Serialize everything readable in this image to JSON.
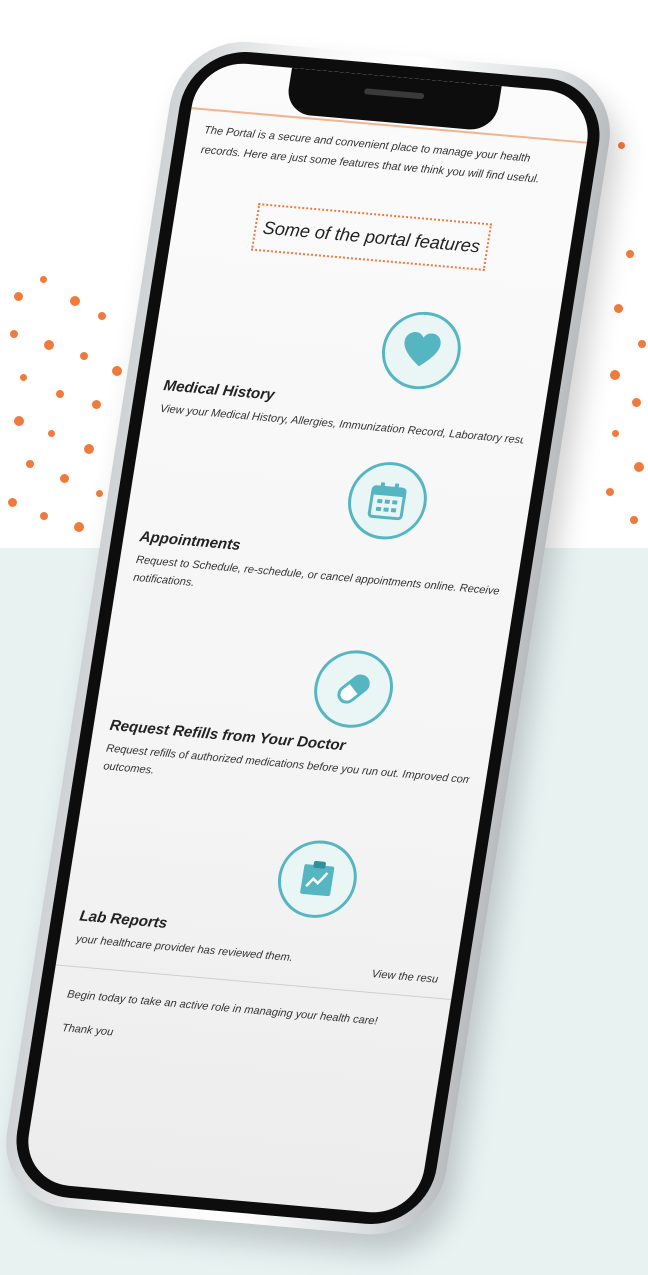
{
  "screen": {
    "intro": "The Portal is a secure and convenient place to manage your health records. Here are just some features that we think you will find useful.",
    "features_heading": "Some of the portal features",
    "features": [
      {
        "title": "Medical History",
        "description": "View your Medical History, Allergies, Immunization Record, Laboratory results, and Current Me",
        "icon": "heart-icon"
      },
      {
        "title": "Appointments",
        "description": "Request to Schedule, re-schedule, or cancel appointments online. Receive appointment confir",
        "description_line2": "notifications.",
        "icon": "calendar-icon"
      },
      {
        "title": "Request Refills from Your Doctor",
        "description": "Request refills of authorized medications before you run out. Improved compliance means impr",
        "description_line2": "outcomes.",
        "icon": "pill-icon"
      },
      {
        "title": "Lab Reports",
        "description": "your healthcare provider has reviewed them.",
        "description_right": "View the resu",
        "icon": "lab-chart-icon"
      }
    ],
    "closing": "Begin today to take an active role in managing your health care!",
    "thanks": "Thank you"
  },
  "colors": {
    "accent_orange": "#f07a3c",
    "icon_teal": "#55b6c2",
    "background_mint": "#e7f2f1"
  }
}
